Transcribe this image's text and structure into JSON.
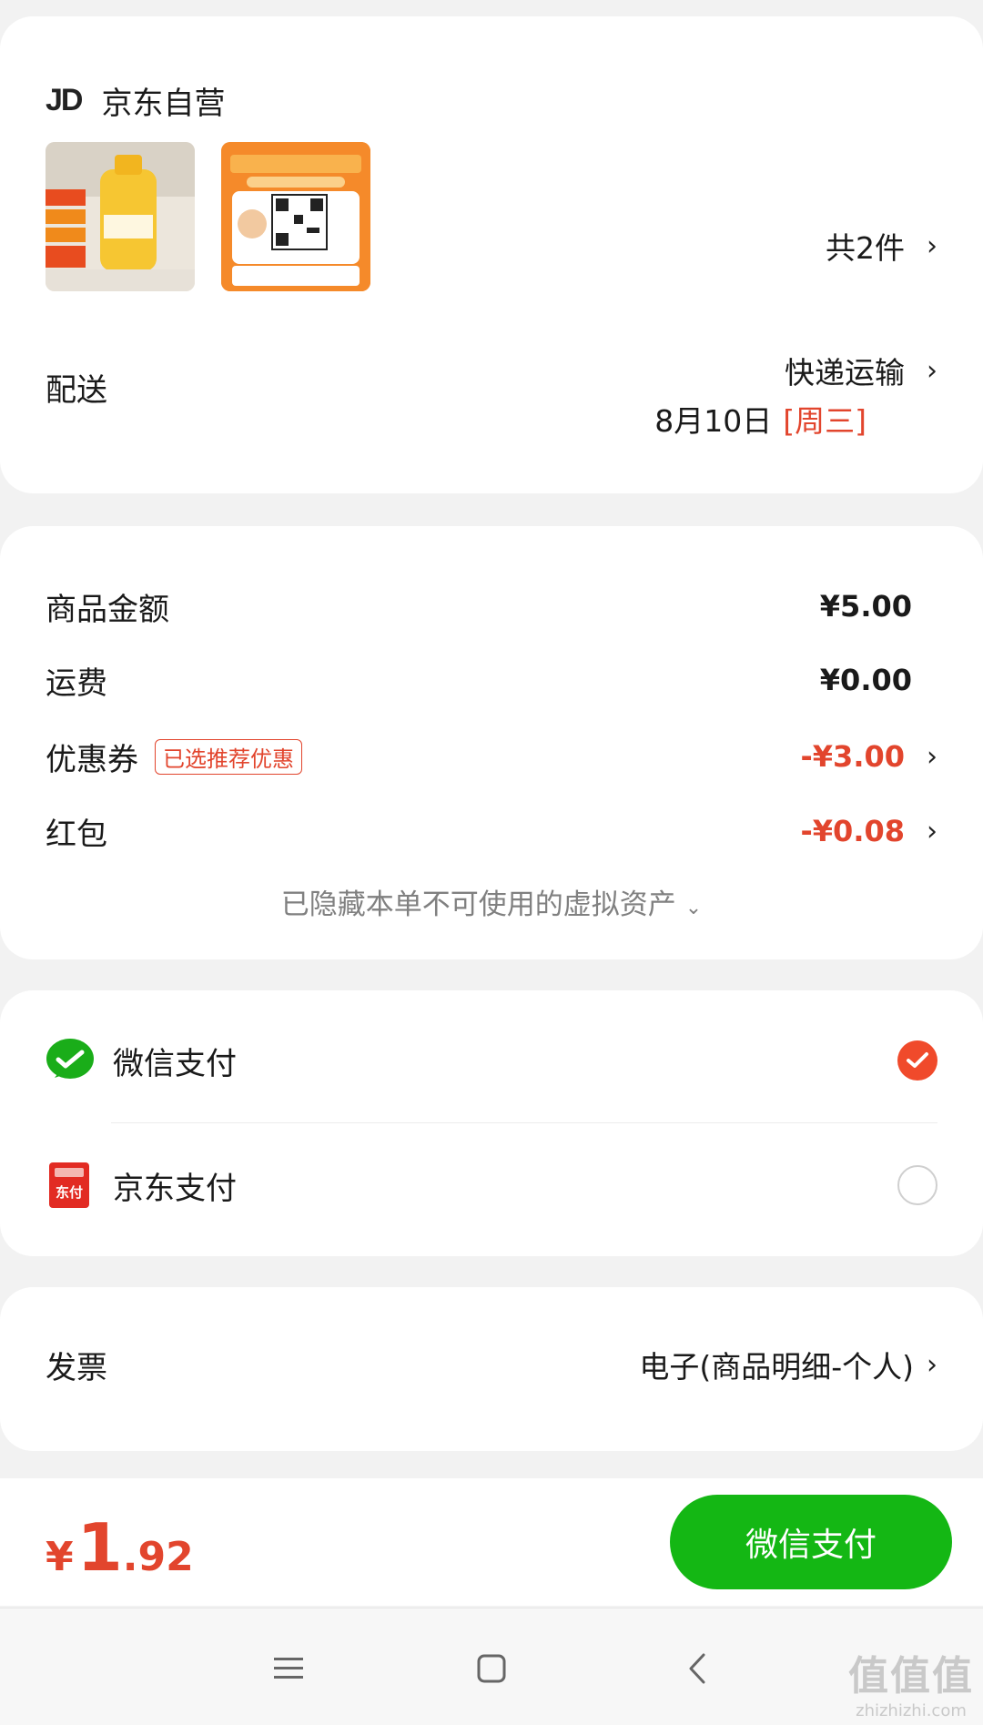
{
  "store": {
    "logo_text": "JD",
    "name": "京东自营"
  },
  "items": {
    "count_label": "共2件"
  },
  "delivery": {
    "label": "配送",
    "method": "快递运输",
    "date": "8月10日",
    "weekday": "[周三]"
  },
  "price_summary": {
    "goods_label": "商品金额",
    "goods_amount": "¥5.00",
    "shipping_label": "运费",
    "shipping_amount": "¥0.00",
    "coupon_label": "优惠券",
    "coupon_tag": "已选推荐优惠",
    "coupon_amount": "-¥3.00",
    "redpacket_label": "红包",
    "redpacket_amount": "-¥0.08",
    "hidden_note": "已隐藏本单不可使用的虚拟资产"
  },
  "payment": {
    "options": [
      {
        "label": "微信支付",
        "selected": true,
        "icon": "wechat-pay-icon"
      },
      {
        "label": "京东支付",
        "selected": false,
        "icon": "jd-pay-icon",
        "icon_text": "东付"
      }
    ]
  },
  "invoice": {
    "label": "发票",
    "value": "电子(商品明细-个人)"
  },
  "footer": {
    "currency": "¥",
    "total_int": "1",
    "total_dec": ".92",
    "pay_button": "微信支付"
  },
  "watermark": {
    "big": "值值值",
    "small": "zhizhizhi.com"
  },
  "colors": {
    "accent_red": "#e2452d",
    "wechat_green": "#14b714",
    "radio_selected": "#f04a2b"
  }
}
